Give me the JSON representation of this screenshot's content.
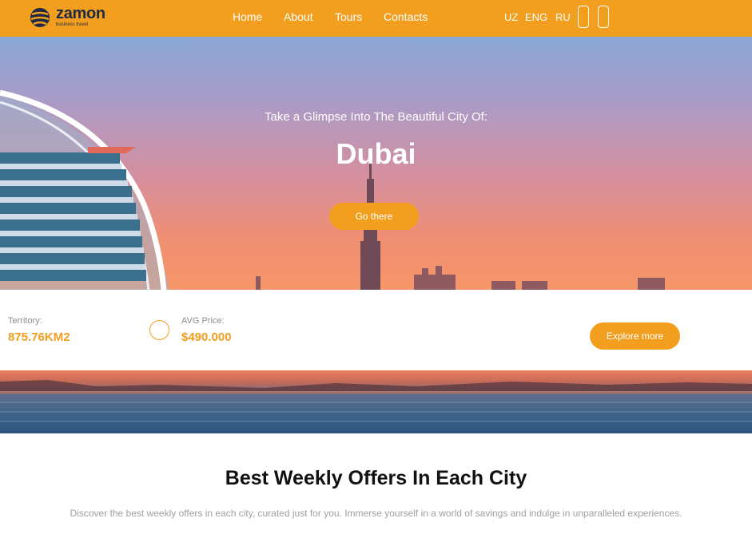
{
  "brand": {
    "name": "zamon",
    "tagline": "business travel",
    "accent": "#f29e1f"
  },
  "nav": {
    "items": [
      "Home",
      "About",
      "Tours",
      "Contacts"
    ]
  },
  "languages": [
    "UZ",
    "ENG",
    "RU"
  ],
  "hero": {
    "subtitle": "Take a Glimpse Into The Beautiful City Of:",
    "city": "Dubai",
    "cta": "Go there"
  },
  "info": {
    "territory_label": "Territory:",
    "territory_value": "875.76KM2",
    "price_label": "AVG Price:",
    "price_value": "$490.000",
    "explore": "Explore more"
  },
  "offers": {
    "title": "Best Weekly Offers In Each City",
    "description": "Discover the best weekly offers in each city, curated just for you. Immerse yourself in a world of savings and indulge in unparalleled experiences."
  }
}
